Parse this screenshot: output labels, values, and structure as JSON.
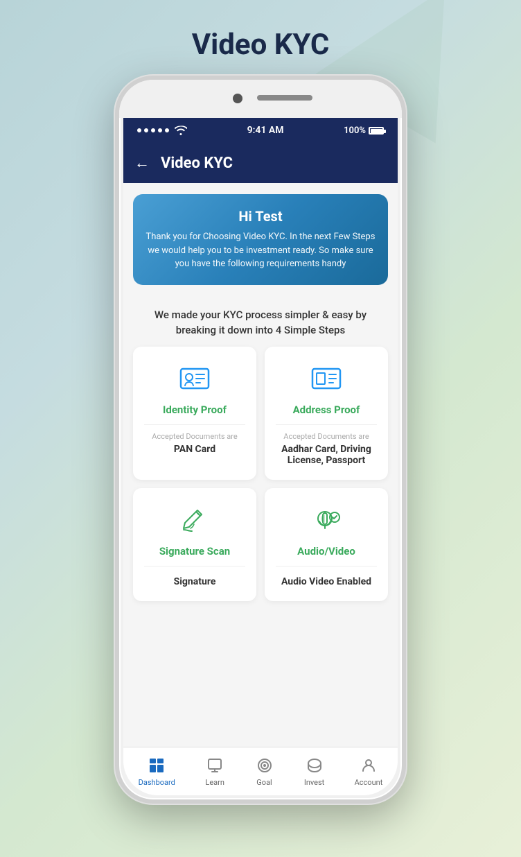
{
  "page": {
    "title": "Video KYC"
  },
  "statusBar": {
    "time": "9:41 AM",
    "battery": "100%",
    "signal": "●●●●●",
    "wifi": "wifi"
  },
  "header": {
    "title": "Video KYC",
    "backLabel": "←"
  },
  "welcomeBanner": {
    "greeting": "Hi Test",
    "message": "Thank you for Choosing Video KYC. In the next Few Steps we would help you to be investment ready. So make sure you have the following requirements handy"
  },
  "description": "We made your KYC process simpler & easy by breaking it down into 4 Simple Steps",
  "cards": [
    {
      "id": "identity-proof",
      "title": "Identity Proof",
      "docsLabel": "Accepted Documents are",
      "docsValue": "PAN Card"
    },
    {
      "id": "address-proof",
      "title": "Address Proof",
      "docsLabel": "Accepted Documents are",
      "docsValue": "Aadhar Card, Driving License, Passport"
    },
    {
      "id": "signature-scan",
      "title": "Signature Scan",
      "docsLabel": "",
      "docsValue": "Signature"
    },
    {
      "id": "audio-video",
      "title": "Audio/Video",
      "docsLabel": "",
      "docsValue": "Audio Video Enabled"
    }
  ],
  "bottomNav": [
    {
      "id": "dashboard",
      "label": "Dashboard",
      "active": true
    },
    {
      "id": "learn",
      "label": "Learn",
      "active": false
    },
    {
      "id": "goal",
      "label": "Goal",
      "active": false
    },
    {
      "id": "invest",
      "label": "Invest",
      "active": false
    },
    {
      "id": "account",
      "label": "Account",
      "active": false
    }
  ]
}
